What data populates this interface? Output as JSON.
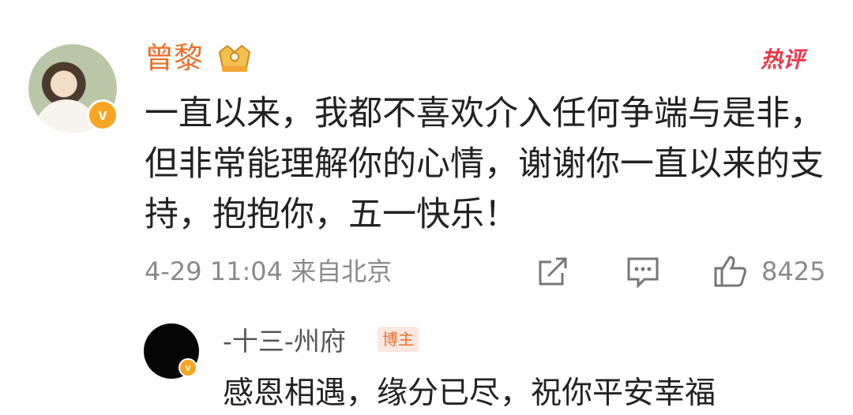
{
  "post": {
    "author": "曾黎",
    "hot_label": "热评",
    "comment_text": "一直以来，我都不喜欢介入任何争端与是非，但非常能理解你的心情，谢谢你一直以来的支持，抱抱你，五一快乐！",
    "timestamp": "4-29 11:04",
    "location": "来自北京",
    "like_count": "8425",
    "verified_badge_glyph": "v"
  },
  "reply": {
    "author": "-十三-州府",
    "role_badge": "博主",
    "text": "感恩相遇，缘分已尽，祝你平安幸福",
    "verified_badge_glyph": "v"
  },
  "colors": {
    "username": "#e8702a",
    "hot": "#e6394a",
    "meta": "#8a8a8a",
    "badge": "#f6a623"
  }
}
